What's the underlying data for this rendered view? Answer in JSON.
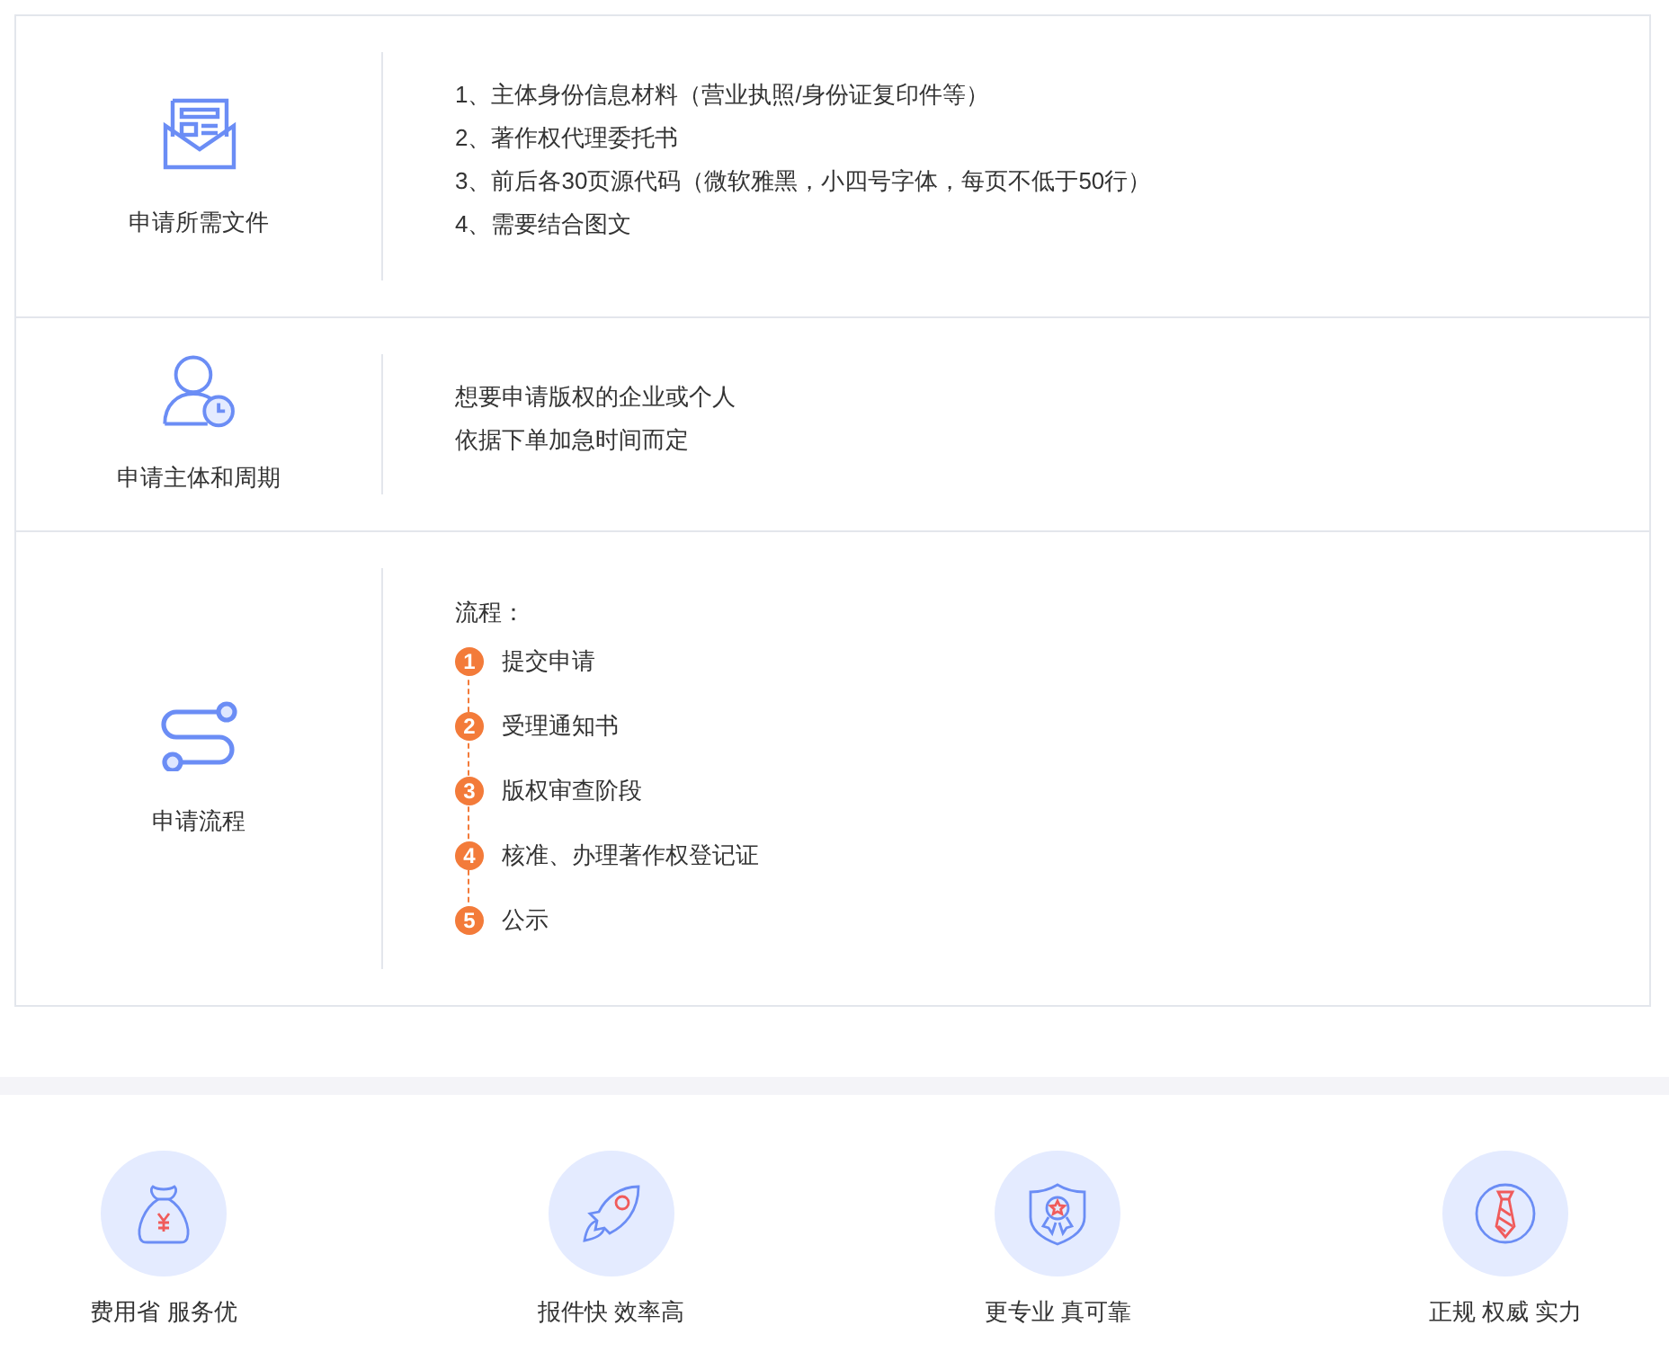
{
  "sections": [
    {
      "title": "申请所需文件",
      "kind": "lines",
      "lines": [
        "1、主体身份信息材料（营业执照/身份证复印件等）",
        "2、著作权代理委托书",
        "3、前后各30页源代码（微软雅黑，小四号字体，每页不低于50行）",
        "4、需要结合图文"
      ]
    },
    {
      "title": "申请主体和周期",
      "kind": "lines",
      "lines": [
        "想要申请版权的企业或个人",
        "依据下单加急时间而定"
      ]
    },
    {
      "title": "申请流程",
      "kind": "steps",
      "heading": "流程：",
      "steps": [
        {
          "number": "1",
          "label": "提交申请"
        },
        {
          "number": "2",
          "label": "受理通知书"
        },
        {
          "number": "3",
          "label": "版权审查阶段"
        },
        {
          "number": "4",
          "label": "核准、办理著作权登记证"
        },
        {
          "number": "5",
          "label": "公示"
        }
      ]
    }
  ],
  "features": [
    "费用省 服务优",
    "报件快 效率高",
    "更专业 真可靠",
    "正规 权威 实力"
  ]
}
